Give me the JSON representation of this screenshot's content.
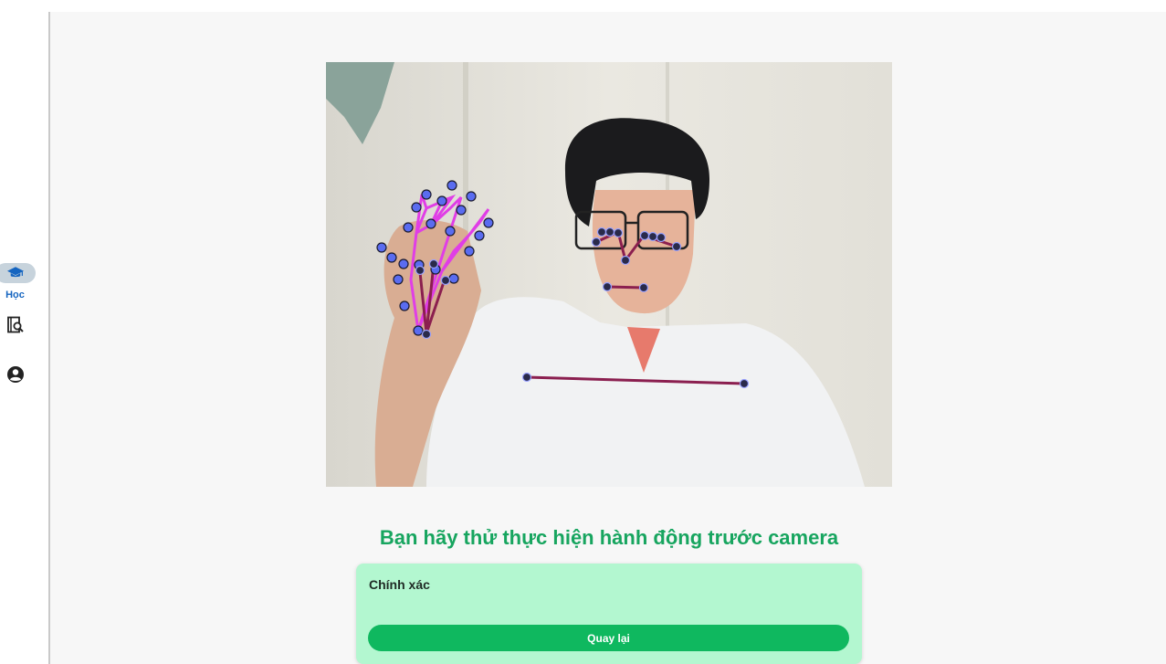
{
  "sidebar": {
    "items": [
      {
        "label": "Học",
        "icon": "graduation-cap-icon",
        "active": true
      },
      {
        "label": "",
        "icon": "dictionary-search-icon",
        "active": false
      },
      {
        "label": "",
        "icon": "account-circle-icon",
        "active": false
      }
    ]
  },
  "main": {
    "prompt": "Bạn hãy thử thực hiện hành động trước camera",
    "result": {
      "status_text": "Chính xác",
      "back_label": "Quay lại"
    }
  },
  "colors": {
    "accent_green": "#17a55f",
    "button_green": "#0fb85f",
    "result_bg": "#b3f7d0",
    "active_nav": "#1565c0",
    "landmark_line": "#e03ee6",
    "landmark_point": "#5a6cf0"
  }
}
